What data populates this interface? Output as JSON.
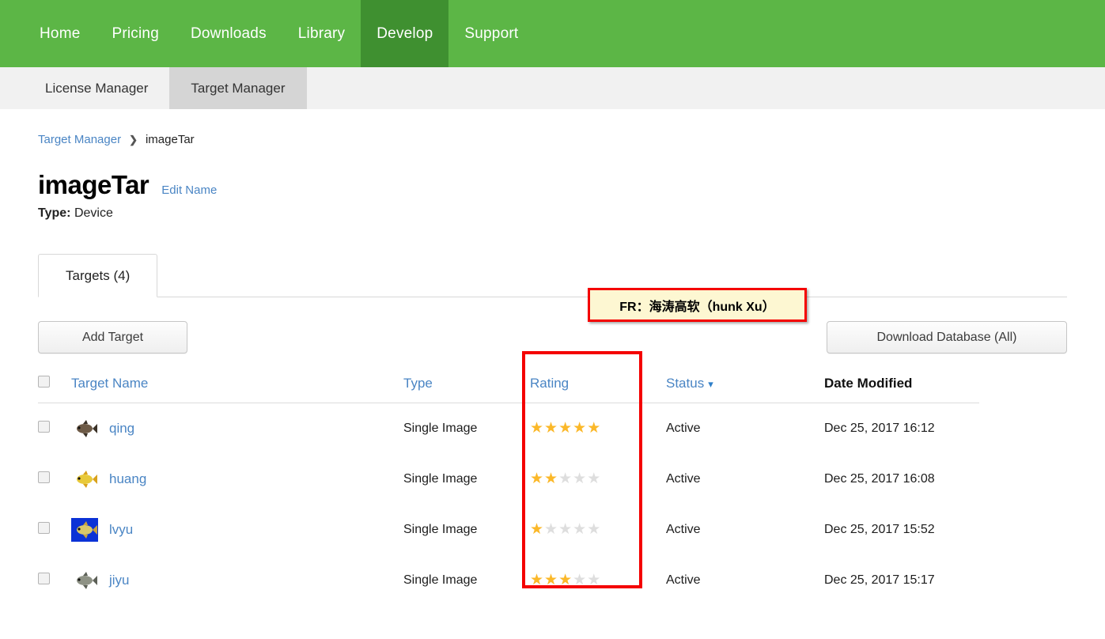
{
  "topnav": {
    "items": [
      {
        "label": "Home",
        "active": false
      },
      {
        "label": "Pricing",
        "active": false
      },
      {
        "label": "Downloads",
        "active": false
      },
      {
        "label": "Library",
        "active": false
      },
      {
        "label": "Develop",
        "active": true
      },
      {
        "label": "Support",
        "active": false
      }
    ]
  },
  "subnav": {
    "items": [
      {
        "label": "License Manager",
        "active": false
      },
      {
        "label": "Target Manager",
        "active": true
      }
    ]
  },
  "breadcrumb": {
    "root": "Target Manager",
    "separator": "❯",
    "current": "imageTar"
  },
  "page": {
    "title": "imageTar",
    "edit_name": "Edit Name",
    "type_label": "Type:",
    "type_value": "Device"
  },
  "annotation": {
    "text": "FR：海涛高软（hunk Xu）",
    "background": "#fdf7d2",
    "border_color": "#f40000"
  },
  "tabs": [
    {
      "label": "Targets (4)",
      "active": true
    }
  ],
  "toolbar": {
    "add_target": "Add Target",
    "download_database": "Download Database (All)"
  },
  "table": {
    "headers": {
      "select_all": "",
      "target_name": "Target Name",
      "type": "Type",
      "rating": "Rating",
      "status": "Status",
      "status_chevron": "⌄",
      "date_modified": "Date Modified"
    },
    "rows": [
      {
        "name": "qing",
        "type": "Single Image",
        "rating": 5,
        "status": "Active",
        "date_modified": "Dec 25, 2017 16:12",
        "thumb": "fish-dark-thumbnail"
      },
      {
        "name": "huang",
        "type": "Single Image",
        "rating": 2,
        "status": "Active",
        "date_modified": "Dec 25, 2017 16:08",
        "thumb": "fish-yellow-thumbnail"
      },
      {
        "name": "lvyu",
        "type": "Single Image",
        "rating": 1,
        "status": "Active",
        "date_modified": "Dec 25, 2017 15:52",
        "thumb": "fish-blue-bg-thumbnail"
      },
      {
        "name": "jiyu",
        "type": "Single Image",
        "rating": 3,
        "status": "Active",
        "date_modified": "Dec 25, 2017 15:17",
        "thumb": "fish-gray-thumbnail"
      }
    ],
    "rating_max": 5,
    "star_on_color": "#fbb829",
    "star_off_color": "#dedede",
    "rating_highlight_color": "#f40000"
  },
  "colors": {
    "nav_green": "#5cb646",
    "nav_green_active": "#3f9030",
    "link_blue": "#4a85c4",
    "subnav_bg": "#f1f1f1",
    "subnav_active": "#d5d5d5"
  }
}
